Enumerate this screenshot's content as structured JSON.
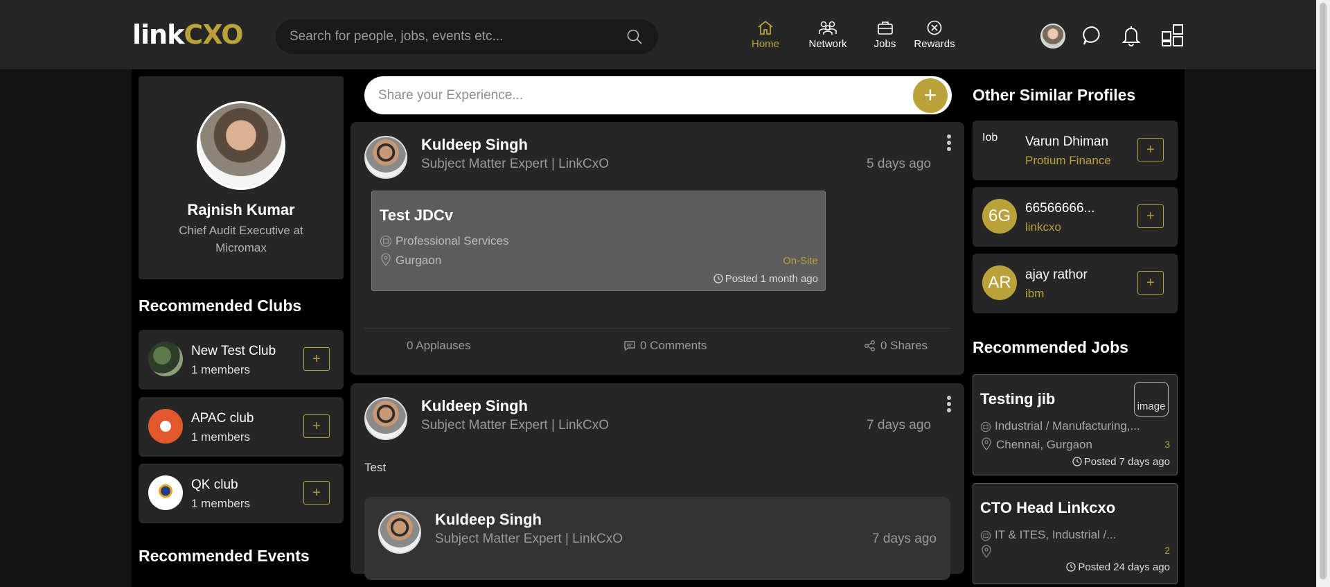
{
  "header": {
    "logo": {
      "part1": "link",
      "part2": "CXO"
    },
    "search_placeholder": "Search for people, jobs, events etc...",
    "nav": [
      {
        "label": "Home",
        "icon": "home-icon",
        "active": true
      },
      {
        "label": "Network",
        "icon": "network-icon",
        "active": false
      },
      {
        "label": "Jobs",
        "icon": "briefcase-icon",
        "active": false
      },
      {
        "label": "Rewards",
        "icon": "rewards-icon",
        "active": false
      }
    ]
  },
  "profile": {
    "name": "Rajnish Kumar",
    "title": "Chief Audit Executive at Micromax"
  },
  "recommended_clubs": {
    "title": "Recommended Clubs",
    "items": [
      {
        "name": "New Test Club",
        "members": "1 members"
      },
      {
        "name": "APAC club",
        "members": "1 members"
      },
      {
        "name": "QK club",
        "members": "1 members"
      }
    ]
  },
  "recommended_events": {
    "title": "Recommended Events"
  },
  "composer": {
    "placeholder": "Share your Experience...",
    "plus": "+"
  },
  "posts": [
    {
      "author": "Kuldeep Singh",
      "subtitle": "Subject Matter Expert | LinkCxO",
      "time": "5 days ago",
      "job": {
        "title": "Test JDCv",
        "industry": "Professional Services",
        "location": "Gurgaon",
        "work_mode": "On-Site",
        "posted": "Posted 1 month ago"
      },
      "applauses": "0 Applauses",
      "comments": "0 Comments",
      "shares": "0 Shares"
    },
    {
      "author": "Kuldeep Singh",
      "subtitle": "Subject Matter Expert | LinkCxO",
      "time": "7 days ago",
      "text": "Test",
      "shared": {
        "author": "Kuldeep Singh",
        "subtitle": "Subject Matter Expert | LinkCxO",
        "time": "7 days ago"
      }
    }
  ],
  "similar_profiles": {
    "title": "Other Similar Profiles",
    "items": [
      {
        "name": "Varun Dhiman",
        "company": "Protium Finance",
        "avatar_text": "Iob",
        "plus": "+"
      },
      {
        "name": "66566666...",
        "company": "linkcxo",
        "avatar_text": "6G",
        "plus": "+"
      },
      {
        "name": "ajay rathor",
        "company": "ibm",
        "avatar_text": "AR",
        "plus": "+"
      }
    ]
  },
  "recommended_jobs": {
    "title": "Recommended Jobs",
    "items": [
      {
        "title": "Testing jib",
        "industry": "Industrial / Manufacturing,...",
        "location": "Chennai, Gurgaon",
        "count": "3",
        "posted": "Posted 7 days ago",
        "image_alt": "image"
      },
      {
        "title": "CTO Head Linkcxo",
        "industry": "IT & ITES, Industrial /...",
        "location": "",
        "count": "2",
        "posted": "Posted 24 days ago"
      }
    ]
  },
  "colors": {
    "accent": "#b9a23a",
    "card": "#262626",
    "background": "#000000"
  }
}
